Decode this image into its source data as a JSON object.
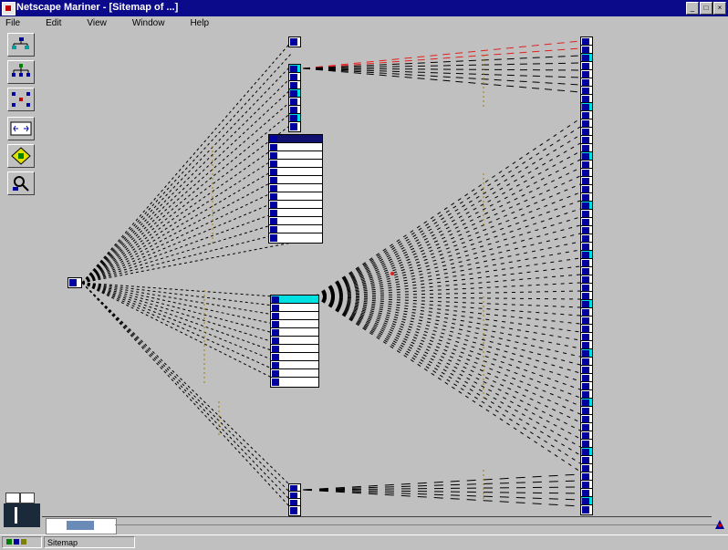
{
  "window": {
    "title": "Netscape Mariner - [Sitemap of ...]",
    "controls": {
      "minimize": "_",
      "maximize": "□",
      "close": "×"
    }
  },
  "menu": [
    "File",
    "Edit",
    "View",
    "Window",
    "Help"
  ],
  "status": {
    "text": "Sitemap"
  },
  "colors": {
    "title_bar": "#0a0a8a",
    "selected_node": "#00e0e0",
    "highlight_link": "#e02020"
  }
}
